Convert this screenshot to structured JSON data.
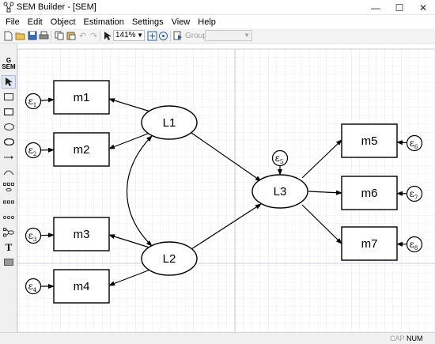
{
  "window": {
    "title": "SEM Builder - [SEM]",
    "controls": [
      "minimize-icon",
      "maximize-icon",
      "close-icon"
    ]
  },
  "menu": [
    "File",
    "Edit",
    "Object",
    "Estimation",
    "Settings",
    "View",
    "Help"
  ],
  "toolbar": {
    "zoom": "141%",
    "group_label": "Group:",
    "group_value": ""
  },
  "lefttools": {
    "gsem_label": "G\nSEM",
    "tools": [
      "select-icon",
      "rectangle-icon",
      "rectangle-icon",
      "ellipse-icon",
      "ellipse-icon",
      "path-arrow-icon",
      "curved-path-icon",
      "measurement-component-icon",
      "regression-component-icon",
      "observed-component-icon",
      "latent-component-icon",
      "text-icon",
      "area-icon"
    ]
  },
  "diagram": {
    "observed": [
      {
        "id": "m1",
        "label": "m1"
      },
      {
        "id": "m2",
        "label": "m2"
      },
      {
        "id": "m3",
        "label": "m3"
      },
      {
        "id": "m4",
        "label": "m4"
      },
      {
        "id": "m5",
        "label": "m5"
      },
      {
        "id": "m6",
        "label": "m6"
      },
      {
        "id": "m7",
        "label": "m7"
      }
    ],
    "latent": [
      {
        "id": "L1",
        "label": "L1"
      },
      {
        "id": "L2",
        "label": "L2"
      },
      {
        "id": "L3",
        "label": "L3"
      }
    ],
    "errors": [
      {
        "id": "e1",
        "symbol": "ε",
        "sub": "1"
      },
      {
        "id": "e2",
        "symbol": "ε",
        "sub": "2"
      },
      {
        "id": "e3",
        "symbol": "ε",
        "sub": "3"
      },
      {
        "id": "e4",
        "symbol": "ε",
        "sub": "4"
      },
      {
        "id": "e5",
        "symbol": "ε",
        "sub": "5"
      },
      {
        "id": "e6",
        "symbol": "ε",
        "sub": "6"
      },
      {
        "id": "e7",
        "symbol": "ε",
        "sub": "7"
      },
      {
        "id": "e8",
        "symbol": "ε",
        "sub": "8"
      }
    ],
    "paths": [
      [
        "L1",
        "m1"
      ],
      [
        "L1",
        "m2"
      ],
      [
        "L2",
        "m3"
      ],
      [
        "L2",
        "m4"
      ],
      [
        "L1",
        "L3"
      ],
      [
        "L2",
        "L3"
      ],
      [
        "L3",
        "m5"
      ],
      [
        "L3",
        "m6"
      ],
      [
        "L3",
        "m7"
      ],
      [
        "e1",
        "m1"
      ],
      [
        "e2",
        "m2"
      ],
      [
        "e3",
        "m3"
      ],
      [
        "e4",
        "m4"
      ],
      [
        "e5",
        "L3"
      ],
      [
        "e6",
        "m5"
      ],
      [
        "e7",
        "m6"
      ],
      [
        "e8",
        "m7"
      ]
    ],
    "covariances": [
      [
        "L1",
        "L2"
      ]
    ]
  },
  "status": {
    "cap": "CAP",
    "num": "NUM"
  }
}
